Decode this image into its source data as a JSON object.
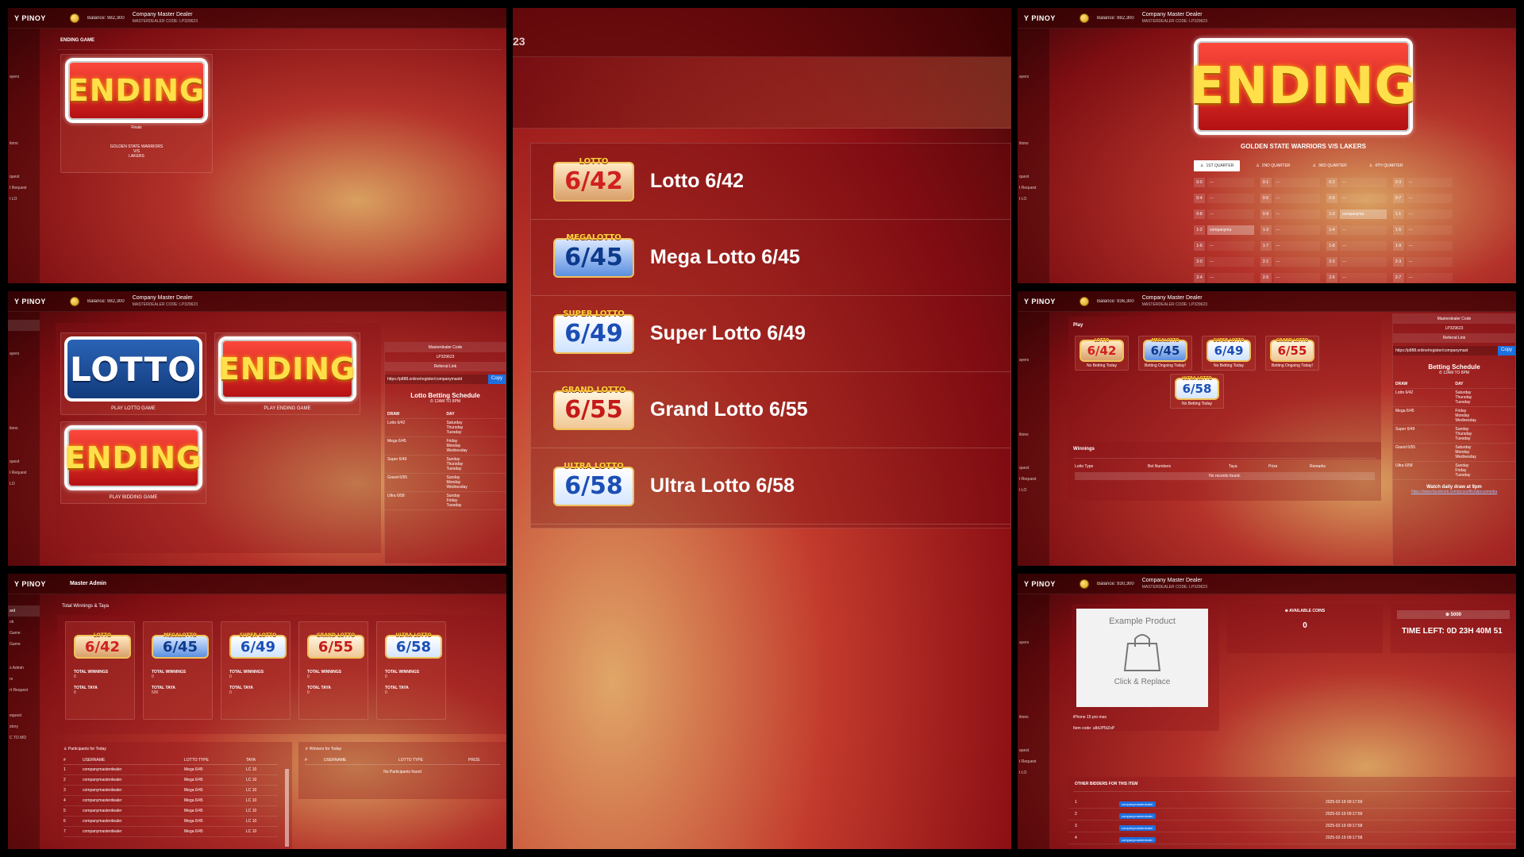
{
  "brand": "Y PINOY",
  "dealer": {
    "name": "Company Master Dealer",
    "code_label": "MASTERDEALER CODE: LP329623"
  },
  "master_admin": "Master Admin",
  "panels": {
    "p1": {
      "balance": "Balance: 982,300",
      "section_title": "ENDING GAME",
      "logo_text": "ENDING",
      "round": "Finals",
      "team_a": "GOLDEN STATE WARRIORS",
      "vs": "V/S",
      "team_b": "LAKERS",
      "sidebar": [
        "ayers",
        "",
        "",
        "tions",
        "",
        "quest",
        "t Request",
        "t LO"
      ]
    },
    "p2": {
      "header_num": "23",
      "games": [
        {
          "badge_top": "LOTTO",
          "badge_num": "6/42",
          "label": "Lotto 6/42"
        },
        {
          "badge_top": "MEGALOTTO",
          "badge_num": "6/45",
          "label": "Mega Lotto 6/45"
        },
        {
          "badge_top": "SUPER LOTTO",
          "badge_num": "6/49",
          "label": "Super Lotto 6/49"
        },
        {
          "badge_top": "GRAND LOTTO",
          "badge_num": "6/55",
          "label": "Grand Lotto 6/55"
        },
        {
          "badge_top": "ULTRA LOTTO",
          "badge_num": "6/58",
          "label": "Ultra Lotto 6/58"
        }
      ]
    },
    "p3": {
      "balance": "Balance: 982,300",
      "logo_text": "ENDING",
      "matchup": "GOLDEN STATE WARRIORS V/S LAKERS",
      "tabs": [
        "1ST QUARTER",
        "2ND QUARTER",
        "3RD QUARTER",
        "4TH QUARTER"
      ],
      "cells": [
        {
          "n": "0-0",
          "v": "—"
        },
        {
          "n": "0-1",
          "v": "—"
        },
        {
          "n": "0-2",
          "v": "—"
        },
        {
          "n": "0-3",
          "v": "—"
        },
        {
          "n": "0-4",
          "v": "—"
        },
        {
          "n": "0-5",
          "v": "—"
        },
        {
          "n": "0-6",
          "v": "—"
        },
        {
          "n": "0-7",
          "v": "—"
        },
        {
          "n": "0-8",
          "v": "—"
        },
        {
          "n": "0-9",
          "v": "—"
        },
        {
          "n": "1-0",
          "v": "companyma"
        },
        {
          "n": "1-1",
          "v": "—"
        },
        {
          "n": "1-2",
          "v": "companyma"
        },
        {
          "n": "1-3",
          "v": "—"
        },
        {
          "n": "1-4",
          "v": "—"
        },
        {
          "n": "1-5",
          "v": "—"
        },
        {
          "n": "1-6",
          "v": "—"
        },
        {
          "n": "1-7",
          "v": "—"
        },
        {
          "n": "1-8",
          "v": "—"
        },
        {
          "n": "1-9",
          "v": "—"
        },
        {
          "n": "2-0",
          "v": "—"
        },
        {
          "n": "2-1",
          "v": "—"
        },
        {
          "n": "2-2",
          "v": "—"
        },
        {
          "n": "2-3",
          "v": "—"
        },
        {
          "n": "2-4",
          "v": "—"
        },
        {
          "n": "2-5",
          "v": "—"
        },
        {
          "n": "2-6",
          "v": "—"
        },
        {
          "n": "2-7",
          "v": "—"
        }
      ],
      "sidebar": [
        "ayers",
        "",
        "",
        "itions",
        "",
        "quest",
        "t Request",
        "t LO"
      ]
    },
    "p4": {
      "balance": "Balance: 982,300",
      "cards": [
        {
          "logo": "LOTTO",
          "caption": "PLAY LOTTO GAME"
        },
        {
          "logo": "ENDING",
          "caption": "PLAY ENDING GAME"
        },
        {
          "logo": "ENDING",
          "caption": "PLAY BIDDING GAME"
        }
      ],
      "code_label": "Masterdealer Code",
      "code_value": "LP329623",
      "ref_label": "Referral Link",
      "ref_url": "https://p888.online/register/companymastd",
      "copy": "Copy",
      "schedule_title": "Lotto Betting Schedule",
      "schedule_time": "⏱ 12AM TO 8PM",
      "schedule_head": [
        "DRAW",
        "DAY"
      ],
      "schedule": [
        {
          "draw": "Lotto 6/42",
          "days": "Saturday\nThursday\nTuesday"
        },
        {
          "draw": "Mega 6/45",
          "days": "Friday\nMonday\nWednesday"
        },
        {
          "draw": "Super 6/49",
          "days": "Sunday\nThursday\nTuesday"
        },
        {
          "draw": "Grand 6/55",
          "days": "Sunday\nMonday\nWednesday"
        },
        {
          "draw": "Ultra 6/58",
          "days": "Sunday\nFriday\nTuesday"
        }
      ],
      "sidebar": [
        "ayers",
        "",
        "",
        "tions",
        "",
        "quest",
        "t Request",
        "LO"
      ]
    },
    "p5": {
      "balance": "Balance: 936,300",
      "play": "Play",
      "games": [
        {
          "top": "LOTTO",
          "num": "6/42",
          "status": "No Betting Today"
        },
        {
          "top": "MEGALOTTO",
          "num": "6/45",
          "status": "Betting Ongoing Today!"
        },
        {
          "top": "SUPER LOTTO",
          "num": "6/49",
          "status": "No Betting Today"
        },
        {
          "top": "GRAND LOTTO",
          "num": "6/55",
          "status": "Betting Ongoing Today!"
        },
        {
          "top": "ULTRA LOTTO",
          "num": "6/58",
          "status": "No Betting Today"
        }
      ],
      "winnings": "Winnings",
      "win_head": [
        "Lotto Type",
        "Bet Numbers",
        "Taya",
        "Prize",
        "Remarks"
      ],
      "no_records": "No records found.",
      "code_label": "Masterdealer Code",
      "code_value": "LP329623",
      "ref_label": "Referral Link",
      "ref_url": "https://p888.online/register/companymast",
      "copy": "Copy",
      "schedule_title": "Betting Schedule",
      "schedule_time": "⏱ 12AM TO 8PM",
      "schedule_head": [
        "DRAW",
        "DAY"
      ],
      "schedule": [
        {
          "draw": "Lotto 6/42",
          "days": "Saturday\nThursday\nTuesday"
        },
        {
          "draw": "Mega 6/45",
          "days": "Friday\nMonday\nWednesday"
        },
        {
          "draw": "Super 6/49",
          "days": "Sunday\nThursday\nTuesday"
        },
        {
          "draw": "Grand 6/55",
          "days": "Saturday\nMonday\nWednesday"
        },
        {
          "draw": "Ultra 6/58",
          "days": "Sunday\nFriday\nTuesday"
        }
      ],
      "watch": "Watch daily draw at 9pm",
      "fb_link": "https://www.facebook.com/pcsoofficialpcsomedia",
      "sidebar": [
        "ayers",
        "",
        "",
        "itions",
        "",
        "quest",
        "t Request",
        "t LO"
      ]
    },
    "p6": {
      "section": "Total Winnings & Taya",
      "cards": [
        {
          "top": "LOTTO",
          "num": "6/42",
          "winnings": "0",
          "taya": "0"
        },
        {
          "top": "MEGALOTTO",
          "num": "6/45",
          "winnings": "0",
          "taya": "500"
        },
        {
          "top": "SUPER LOTTO",
          "num": "6/49",
          "winnings": "0",
          "taya": "0"
        },
        {
          "top": "GRAND LOTTO",
          "num": "6/55",
          "winnings": "0",
          "taya": "0"
        },
        {
          "top": "ULTRA LOTTO",
          "num": "6/58",
          "winnings": "0",
          "taya": "0"
        }
      ],
      "tw_label": "TOTAL WINNINGS",
      "tt_label": "TOTAL TAYA",
      "participants_title": "♙ Participants for Today",
      "participants_head": [
        "#",
        "USERNAME",
        "LOTTO TYPE",
        "TAYA"
      ],
      "participants": [
        {
          "n": "1",
          "u": "companymasterdealer",
          "t": "Mega 6/45",
          "taya": "LC 10"
        },
        {
          "n": "2",
          "u": "companymasterdealer",
          "t": "Mega 6/45",
          "taya": "LC 10"
        },
        {
          "n": "3",
          "u": "companymasterdealer",
          "t": "Mega 6/45",
          "taya": "LC 10"
        },
        {
          "n": "4",
          "u": "companymasterdealer",
          "t": "Mega 6/45",
          "taya": "LC 10"
        },
        {
          "n": "5",
          "u": "companymasterdealer",
          "t": "Mega 6/45",
          "taya": "LC 10"
        },
        {
          "n": "6",
          "u": "companymasterdealer",
          "t": "Mega 6/45",
          "taya": "LC 10"
        },
        {
          "n": "7",
          "u": "companymasterdealer",
          "t": "Mega 6/45",
          "taya": "LC 10"
        }
      ],
      "winners_title": "♕ Winners for Today",
      "winners_head": [
        "#",
        "USERNAME",
        "LOTTO TYPE",
        "PRIZE"
      ],
      "no_participants": "No Participants found",
      "sidebar": [
        "ard",
        "ok",
        "Game",
        "Game",
        "",
        "s Admin",
        "rs",
        "rt Request",
        "",
        "equest",
        "story",
        "C TO MD"
      ]
    },
    "p7": {
      "balance": "Balance: 930,300",
      "product_title": "Example Product",
      "product_cta": "Click & Replace",
      "product_name": "iPhone 15 pro max",
      "item_code": "Item code: u8dJP5tZoP",
      "coins_label": "⊕ AVAILABLE COINS",
      "coins_value": "0",
      "bid_amount": "⊕ 5000",
      "time_left": "TIME LEFT: 0D 23H 40M 51",
      "others_title": "OTHER BIDDERS FOR THIS ITEM",
      "bidders": [
        {
          "n": "1",
          "user": "companymasterdealer",
          "time": "2025-02-19 09:17:59"
        },
        {
          "n": "2",
          "user": "companymasterdealer",
          "time": "2025-02-19 09:17:59"
        },
        {
          "n": "3",
          "user": "companymasterdealer",
          "time": "2025-02-19 09:17:58"
        },
        {
          "n": "4",
          "user": "companymasterdealer",
          "time": "2025-02-19 09:17:58"
        }
      ],
      "sidebar": [
        "ayers",
        "",
        "",
        "itions",
        "",
        "quest",
        "t Request",
        "t LO"
      ]
    }
  }
}
